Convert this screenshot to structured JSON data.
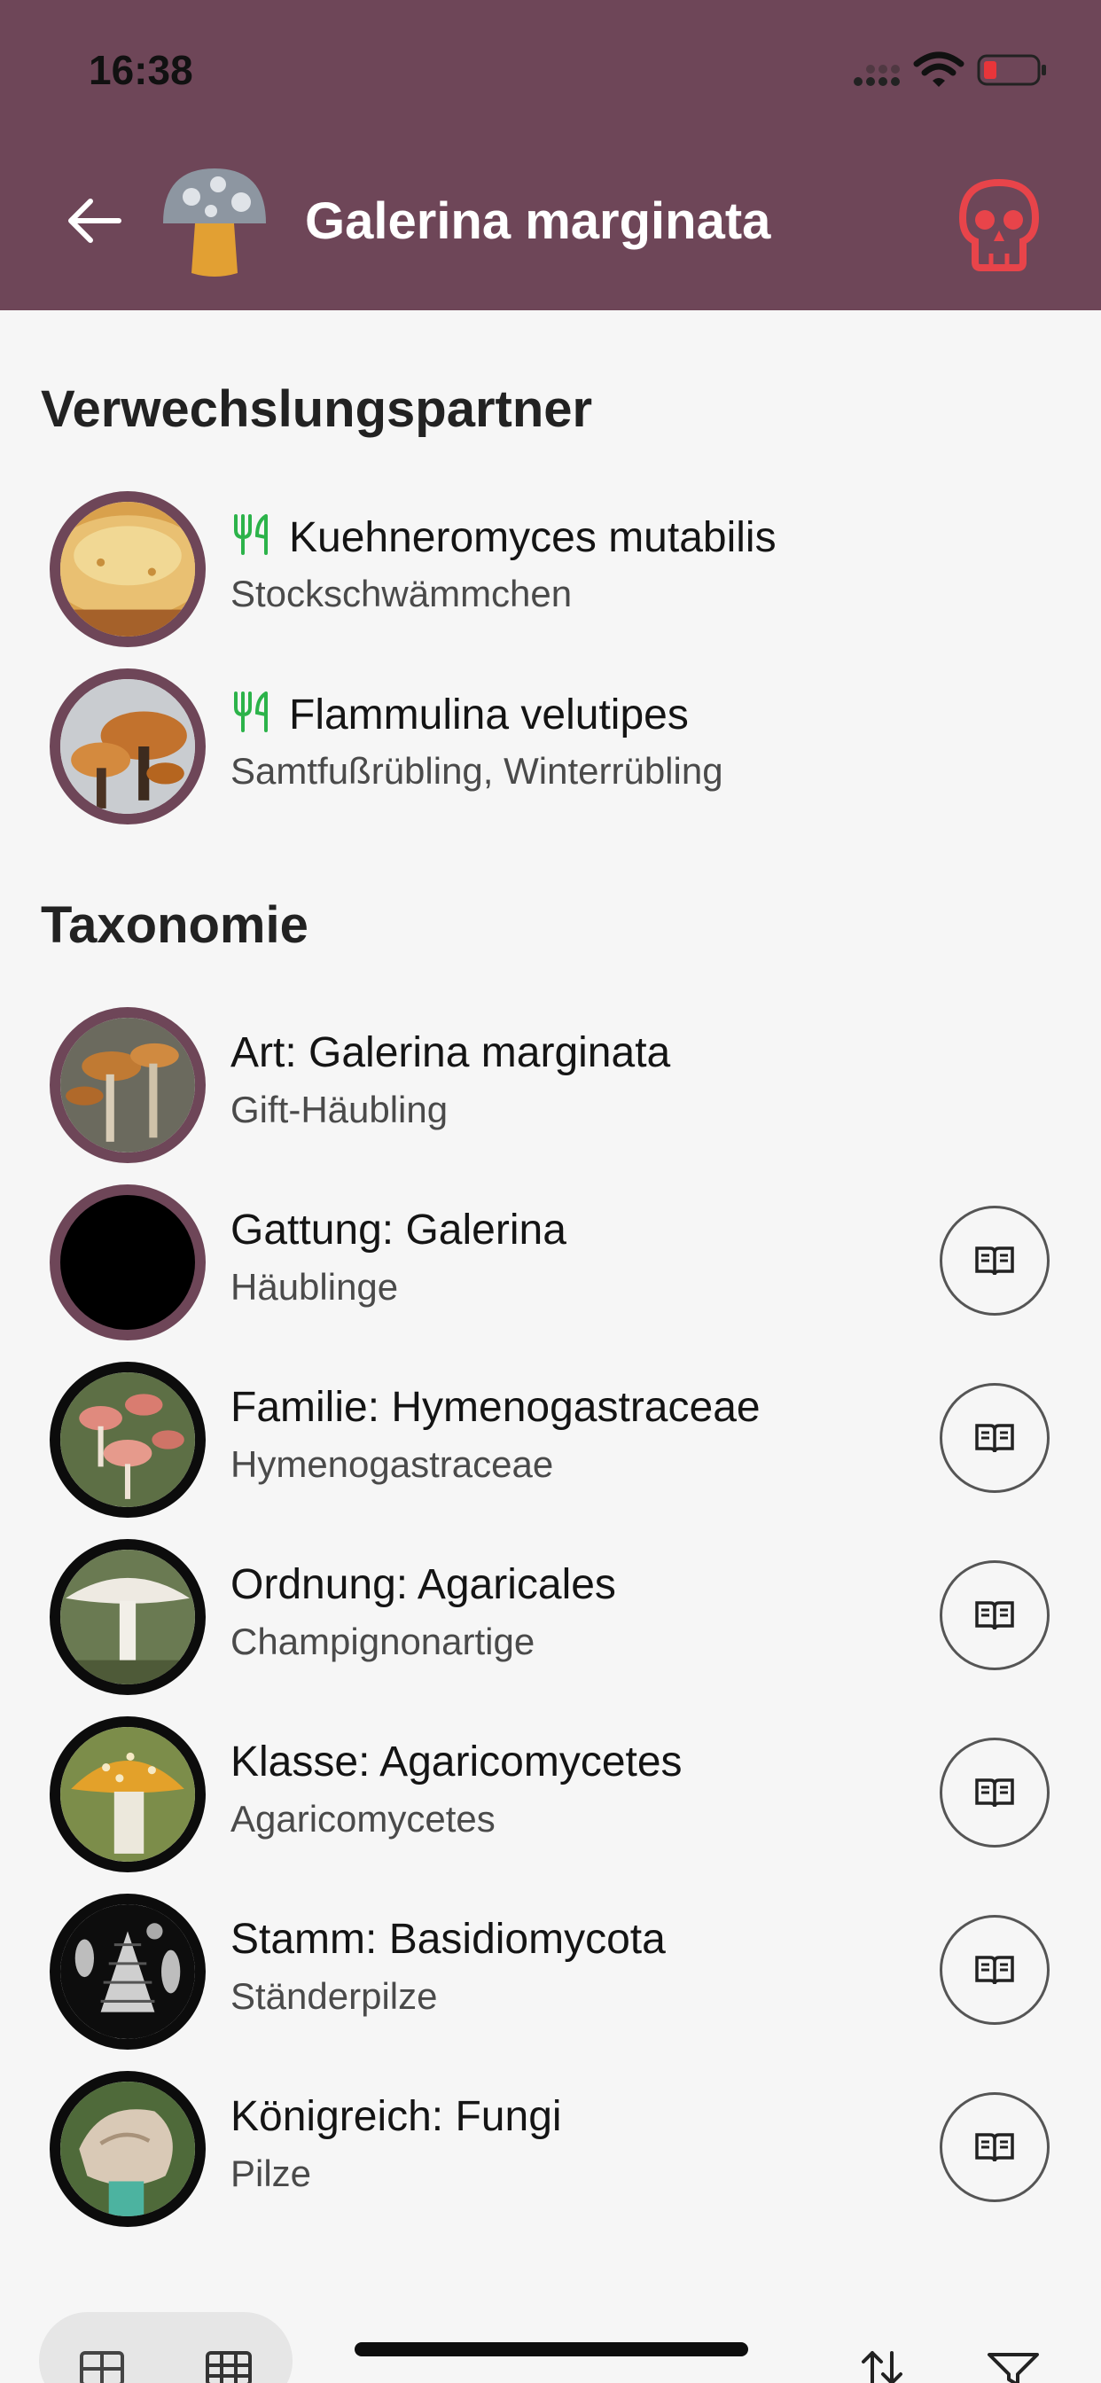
{
  "status_bar": {
    "time": "16:38"
  },
  "header": {
    "title": "Galerina marginata",
    "back_icon": "arrow-left-icon",
    "logo_icon": "mushroom-logo-icon",
    "toxicity_icon": "skull-icon",
    "background": "#6e4658",
    "toxicity_color": "#e8444a"
  },
  "lookalikes": {
    "title": "Verwechslungspartner",
    "items": [
      {
        "name": "Kuehneromyces mutabilis",
        "common": "Stockschwämmchen",
        "edible_icon": "fork-knife-icon"
      },
      {
        "name": "Flammulina velutipes",
        "common": "Samtfußrübling, Winterrübling",
        "edible_icon": "fork-knife-icon"
      }
    ]
  },
  "taxonomy": {
    "title": "Taxonomie",
    "items": [
      {
        "rank": "Art: Galerina marginata",
        "common": "Gift-Häubling"
      },
      {
        "rank": "Gattung: Galerina",
        "common": "Häublinge"
      },
      {
        "rank": "Familie: Hymenogastraceae",
        "common": "Hymenogastraceae"
      },
      {
        "rank": "Ordnung: Agaricales",
        "common": "Champignonartige"
      },
      {
        "rank": "Klasse: Agaricomycetes",
        "common": "Agaricomycetes"
      },
      {
        "rank": "Stamm: Basidiomycota",
        "common": "Ständerpilze"
      },
      {
        "rank": "Königreich: Fungi",
        "common": "Pilze"
      }
    ]
  },
  "accent_colors": {
    "edible": "#2cb34a",
    "border": "#6e4658"
  }
}
